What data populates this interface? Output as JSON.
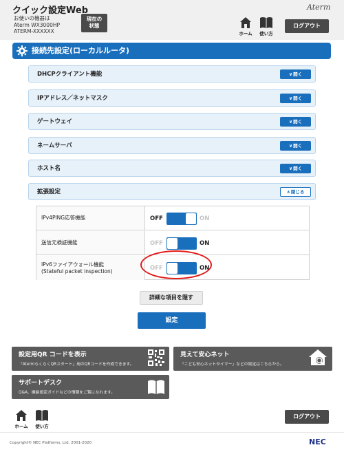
{
  "header": {
    "title": "クイック設定Web",
    "device_caption": "お使いの機器は",
    "device_model": "Aterm WX3000HP",
    "device_name": "ATERM-XXXXXX",
    "status_button_line1": "現在の",
    "status_button_line2": "状態",
    "home_label": "ホーム",
    "help_label": "使い方",
    "brand": "Aterm",
    "logout_label": "ログアウト"
  },
  "section": {
    "title": "接続先設定(ローカルルータ)"
  },
  "accordion": {
    "items": [
      {
        "label": "DHCPクライアント機能",
        "button": "開く",
        "state": "closed"
      },
      {
        "label": "IPアドレス／ネットマスク",
        "button": "開く",
        "state": "closed"
      },
      {
        "label": "ゲートウェイ",
        "button": "開く",
        "state": "closed"
      },
      {
        "label": "ネームサーバ",
        "button": "開く",
        "state": "closed"
      },
      {
        "label": "ホスト名",
        "button": "開く",
        "state": "closed"
      },
      {
        "label": "拡張設定",
        "button": "閉じる",
        "state": "open"
      }
    ]
  },
  "settings": {
    "rows": [
      {
        "label": "IPv4PING応答機能",
        "label2": "",
        "off": "OFF",
        "on": "ON",
        "value": "OFF"
      },
      {
        "label": "送信元検証機能",
        "label2": "",
        "off": "OFF",
        "on": "ON",
        "value": "ON"
      },
      {
        "label": "IPv6ファイアウォール機能",
        "label2": "(Stateful packet inspection)",
        "off": "OFF",
        "on": "ON",
        "value": "ON"
      }
    ]
  },
  "actions": {
    "hide_details": "詳細な項目を隠す",
    "apply": "設定"
  },
  "cards": {
    "qr": {
      "title": "設定用QR コードを表示",
      "desc": "「AtermらくらくQRスタート」用のQRコードを作成できます。"
    },
    "safety": {
      "title": "見えて安心ネット",
      "desc": "「こども安心ネットタイマー」などの設定はこちらから。"
    },
    "support": {
      "title": "サポートデスク",
      "desc": "Q&A、機能設定ガイドなどの情報をご覧になれます。"
    }
  },
  "footer": {
    "home_label": "ホーム",
    "help_label": "使い方",
    "logout_label": "ログアウト",
    "copyright": "Copyright© NEC Platforms, Ltd. 2001-2020",
    "logo": "NEC"
  },
  "colors": {
    "accent": "#1a6fbd",
    "dark_button": "#4a4a4a",
    "card": "#5a5a5a",
    "highlight": "#e21a1a"
  },
  "icons": [
    "home-icon",
    "book-icon",
    "gear-icon",
    "chevron-down-icon",
    "chevron-up-icon",
    "qr-code-icon",
    "house-search-icon"
  ]
}
